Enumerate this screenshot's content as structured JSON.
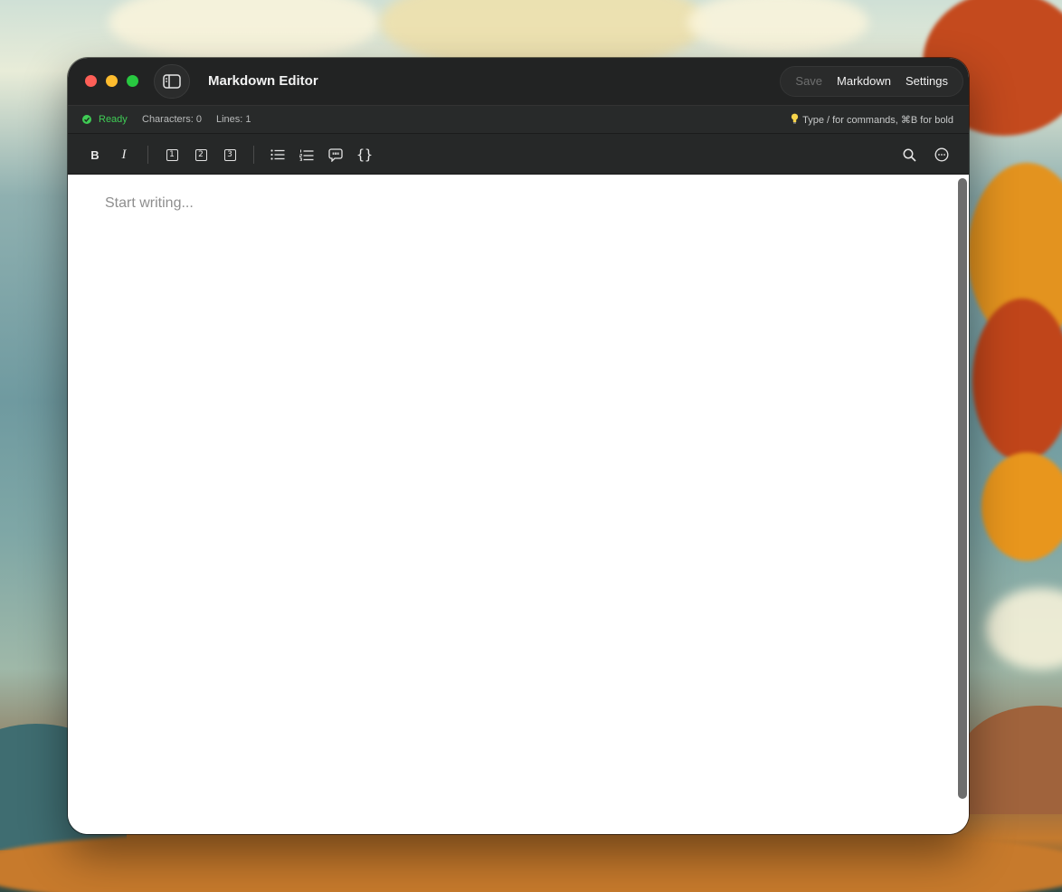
{
  "window": {
    "title": "Markdown Editor",
    "actions": {
      "save_label": "Save",
      "markdown_label": "Markdown",
      "settings_label": "Settings"
    }
  },
  "status": {
    "ready_label": "Ready",
    "characters_text": "Characters: 0",
    "lines_text": "Lines: 1",
    "hint_text": "Type / for commands, ⌘B for bold"
  },
  "toolbar": {
    "bold_label": "B",
    "italic_label": "I",
    "h1_label": "1",
    "h2_label": "2",
    "h3_label": "3",
    "code_label": "{}"
  },
  "editor": {
    "placeholder": "Start writing..."
  },
  "colors": {
    "titlebar": "#222323",
    "ready_green": "#3fcc55",
    "close": "#fe5f57",
    "minimize": "#febc2e",
    "maximize": "#28c840"
  },
  "icons": {
    "sidebar_toggle": "sidebar-icon",
    "bullet_list": "bullet-list-icon",
    "numbered_list": "numbered-list-icon",
    "quote": "quote-icon",
    "search": "search-icon",
    "more": "more-icon",
    "status": "check-circle-icon",
    "hint": "lightbulb-icon"
  }
}
